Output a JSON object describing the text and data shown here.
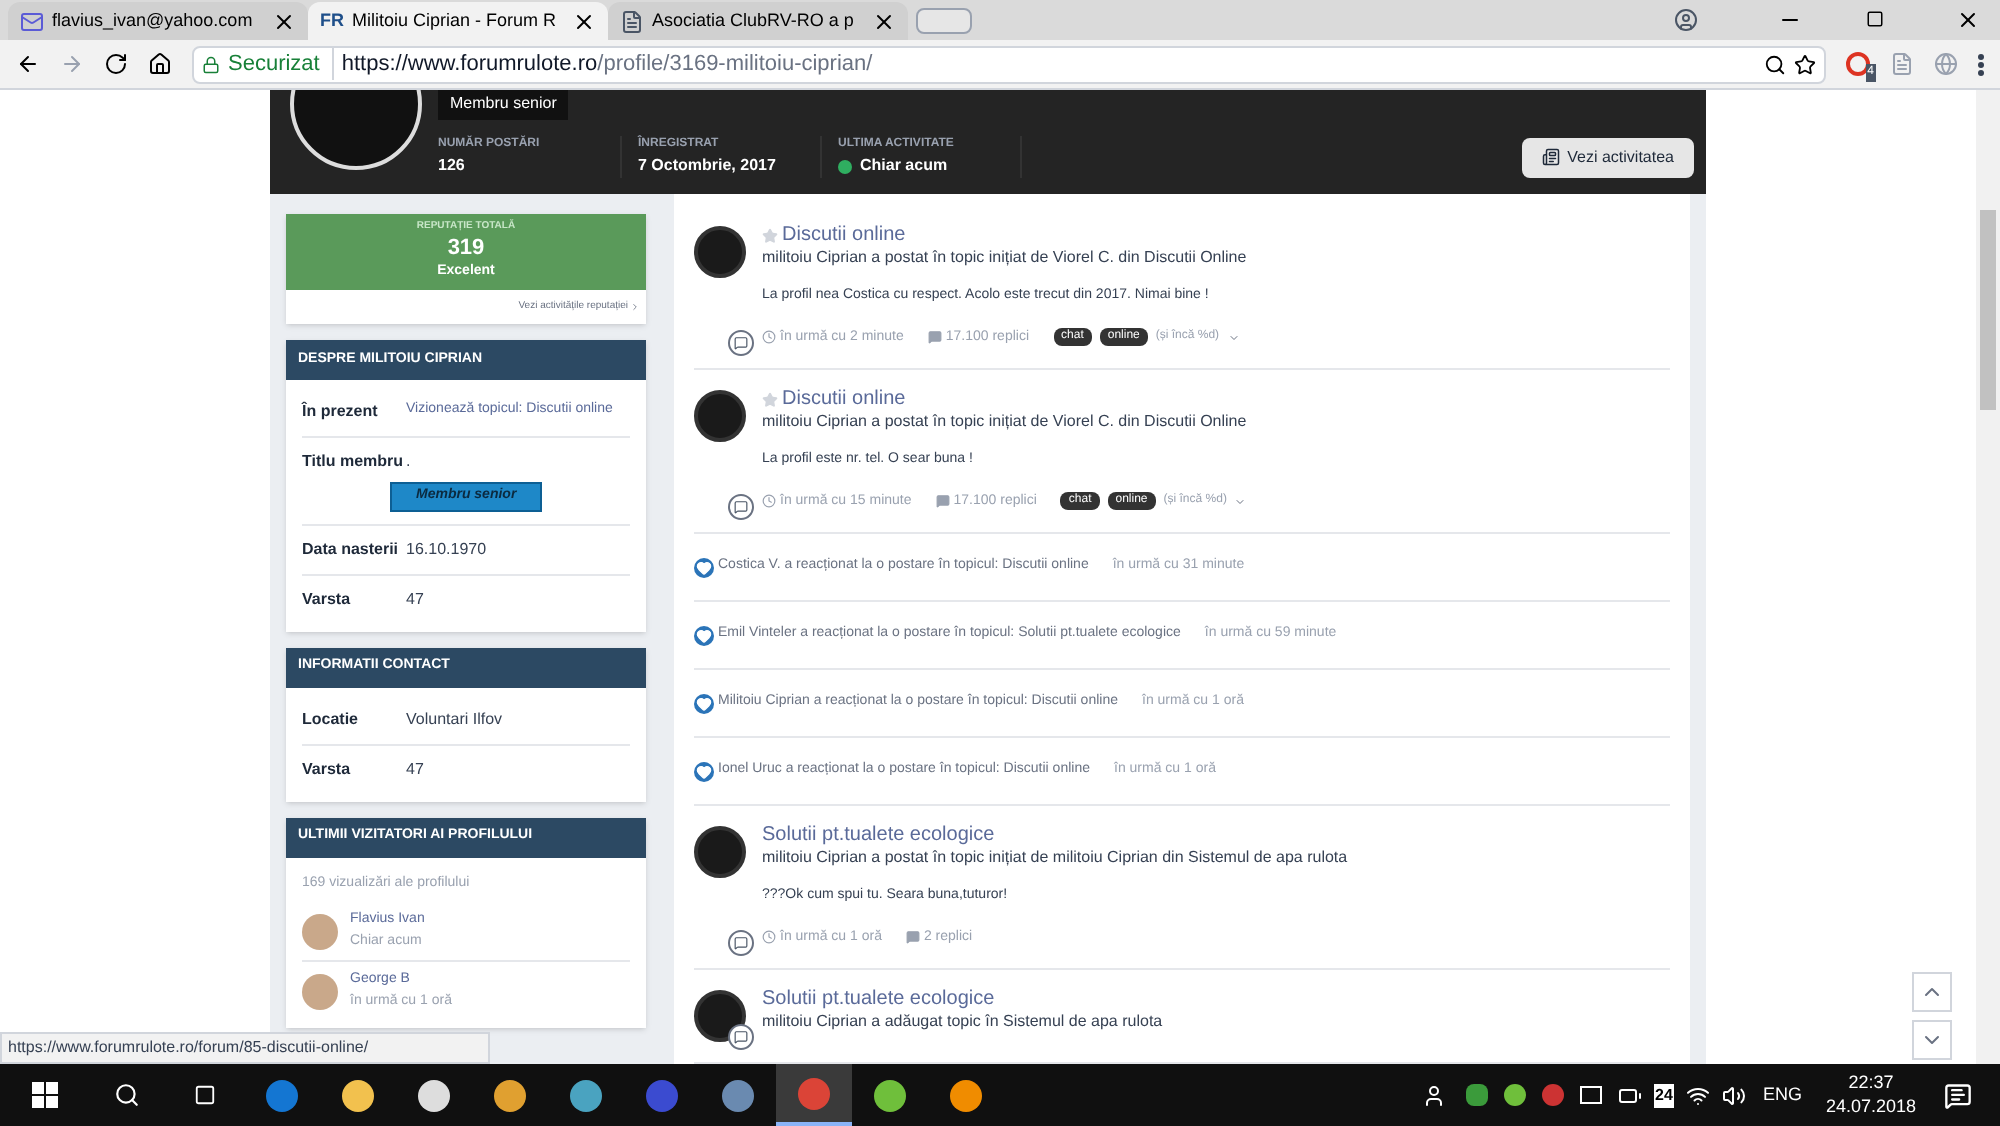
{
  "browser": {
    "tabs": [
      {
        "title": "flavius_ivan@yahoo.com",
        "selected": false
      },
      {
        "title": "Militoiu Ciprian - Forum R",
        "logo_text": "FR",
        "selected": true
      },
      {
        "title": "Asociatia ClubRV-RO a p",
        "selected": false
      }
    ],
    "secure_label": "Securizat",
    "url_host": "https://www.forumrulote.ro",
    "url_path": "/profile/3169-militoiu-ciprian/",
    "extension_badge": "4"
  },
  "profile": {
    "member_badge": "Membru senior",
    "stats": [
      {
        "label": "NUMĂR POSTĂRI",
        "value": "126",
        "online": false
      },
      {
        "label": "ÎNREGISTRAT",
        "value": "7 Octombrie, 2017",
        "online": false
      },
      {
        "label": "ULTIMA ACTIVITATE",
        "value": "Chiar acum",
        "online": true
      }
    ],
    "activity_button": "Vezi activitatea"
  },
  "reputation": {
    "label": "REPUTAȚIE TOTALĂ",
    "value": "319",
    "rank": "Excelent",
    "link": "Vezi activitățile reputației"
  },
  "about": {
    "title": "DESPRE MILITOIU CIPRIAN",
    "rows": [
      {
        "label": "În prezent",
        "value": "Vizionează topicul: Discutii online",
        "kind": "link"
      },
      {
        "label": "Titlu membru",
        "value": ".",
        "ribbon": "Membru senior",
        "kind": "ribbon"
      },
      {
        "label": "Data nasterii",
        "value": "16.10.1970",
        "kind": "text"
      },
      {
        "label": "Varsta",
        "value": "47",
        "kind": "text"
      }
    ]
  },
  "contact": {
    "title": "INFORMATII CONTACT",
    "rows": [
      {
        "label": "Locatie",
        "value": "Voluntari Ilfov",
        "kind": "text"
      },
      {
        "label": "Varsta",
        "value": "47",
        "kind": "text"
      }
    ]
  },
  "visitors": {
    "title": "ULTIMII VIZITATORI AI PROFILULUI",
    "count": "169 vizualizări ale profilului",
    "items": [
      {
        "name": "Flavius Ivan",
        "time": "Chiar acum"
      },
      {
        "name": "George B",
        "time": "în urmă cu 1 oră"
      }
    ]
  },
  "feed": [
    {
      "kind": "post",
      "star": true,
      "title": "Discutii online",
      "byline": "militoiu Ciprian a postat în topic inițiat de Viorel C. din Discutii Online",
      "body": "La profil nea Costica cu respect. Acolo este trecut din 2017. Nimai bine !",
      "time": "în urmă cu 2 minute",
      "replies": "17.100 replici",
      "tags": [
        "chat",
        "online"
      ],
      "more": "(și încă %d)"
    },
    {
      "kind": "post",
      "star": true,
      "title": "Discutii online",
      "byline": "militoiu Ciprian a postat în topic inițiat de Viorel C. din Discutii Online",
      "body": "La profil este nr. tel. O sear buna !",
      "time": "în urmă cu 15 minute",
      "replies": "17.100 replici",
      "tags": [
        "chat",
        "online"
      ],
      "more": "(și încă %d)"
    },
    {
      "kind": "reaction",
      "text": "Costica V. a reacționat la o postare în topicul: Discutii online",
      "time": "în urmă cu 31 minute"
    },
    {
      "kind": "reaction",
      "text": "Emil Vinteler a reacționat la o postare în topicul: Solutii pt.tualete ecologice",
      "time": "în urmă cu 59 minute"
    },
    {
      "kind": "reaction",
      "text": "Militoiu Ciprian a reacționat la o postare în topicul: Discutii online",
      "time": "în urmă cu 1 oră"
    },
    {
      "kind": "reaction",
      "text": "Ionel Uruc a reacționat la o postare în topicul: Discutii online",
      "time": "în urmă cu 1 oră"
    },
    {
      "kind": "post",
      "star": false,
      "title": "Solutii pt.tualete ecologice",
      "byline": "militoiu Ciprian a postat în topic inițiat de militoiu Ciprian din Sistemul de apa rulota",
      "body": "???Ok cum spui tu. Seara buna,tuturor!",
      "time": "în urmă cu 1 oră",
      "replies": "2 replici"
    },
    {
      "kind": "post",
      "star": false,
      "title": "Solutii pt.tualete ecologice",
      "byline": "militoiu Ciprian a adăugat topic în Sistemul de apa rulota"
    }
  ],
  "status_url": "https://www.forumrulote.ro/forum/85-discutii-online/",
  "taskbar": {
    "apps": [
      {
        "active": false
      },
      {
        "active": false
      },
      {
        "active": false
      },
      {
        "active": false
      },
      {
        "active": false
      },
      {
        "active": false
      },
      {
        "active": false
      },
      {
        "active": true
      },
      {
        "active": false
      },
      {
        "active": false
      }
    ],
    "tray_badge": "24",
    "language": "ENG",
    "time": "22:37",
    "date": "24.07.2018"
  }
}
